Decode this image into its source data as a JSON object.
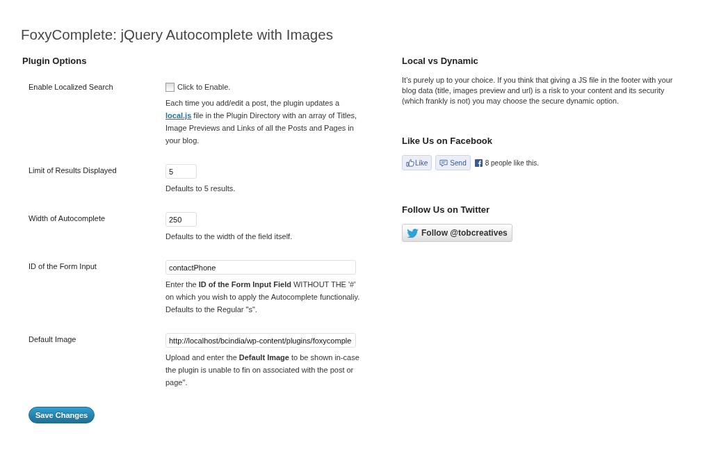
{
  "title": "FoxyComplete: jQuery Autocomplete with Images",
  "options_heading": "Plugin Options",
  "options": [
    {
      "label": "Enable Localized Search",
      "kind": "checkbox",
      "checked": false,
      "control_label": "Click to Enable.",
      "description": [
        {
          "kind": "text",
          "text": "Each time you add/edit a post, the plugin updates a"
        },
        {
          "kind": "link",
          "text": "local.js"
        },
        {
          "kind": "text",
          "text": "file in the Plugin Directory with an array of Titles, Image Previews and Links of all the Posts and Pages in your blog."
        }
      ]
    },
    {
      "label": "Limit of Results Displayed",
      "kind": "short",
      "value": "5",
      "description": [
        {
          "kind": "text",
          "text": "Defaults to 5 results."
        }
      ]
    },
    {
      "label": "Width of Autocomplete",
      "kind": "short",
      "value": "250",
      "description": [
        {
          "kind": "text",
          "text": "Defaults to the width of the field itself."
        }
      ]
    },
    {
      "label": "ID of the Form Input",
      "kind": "wide",
      "value": "contactPhone",
      "description": [
        {
          "kind": "text",
          "text": "Enter the **ID of the Form Input Field** WITHOUT THE '#' on which you wish to apply the Autocomplete functionaliy. Defaults to the Regular \"s\"."
        }
      ]
    },
    {
      "label": "Default Image",
      "kind": "wide",
      "value": "http://localhost/bcindia/wp-content/plugins/foxycomple",
      "description": [
        {
          "kind": "text",
          "text": "Upload and enter the **Default Image** to be shown in-case the plugin is unable to fin on associated with the post or page\"."
        }
      ]
    }
  ],
  "save_button": "Save Changes",
  "sidebar": [
    {
      "kind": "text",
      "heading": "Local vs Dynamic",
      "text": "It’s purely up to your choice. If you think that giving a JS file in the footer with your blog data (title, images preview and url) is a risk to your content and its security (which frankly is not) you may choose the secure dynamic option."
    },
    {
      "kind": "facebook",
      "heading": "Like Us on Facebook",
      "like": "Like",
      "send": "Send",
      "count": "8 people like this."
    },
    {
      "kind": "twitter",
      "heading": "Follow Us on Twitter",
      "button": "Follow @tobcreatives"
    }
  ]
}
